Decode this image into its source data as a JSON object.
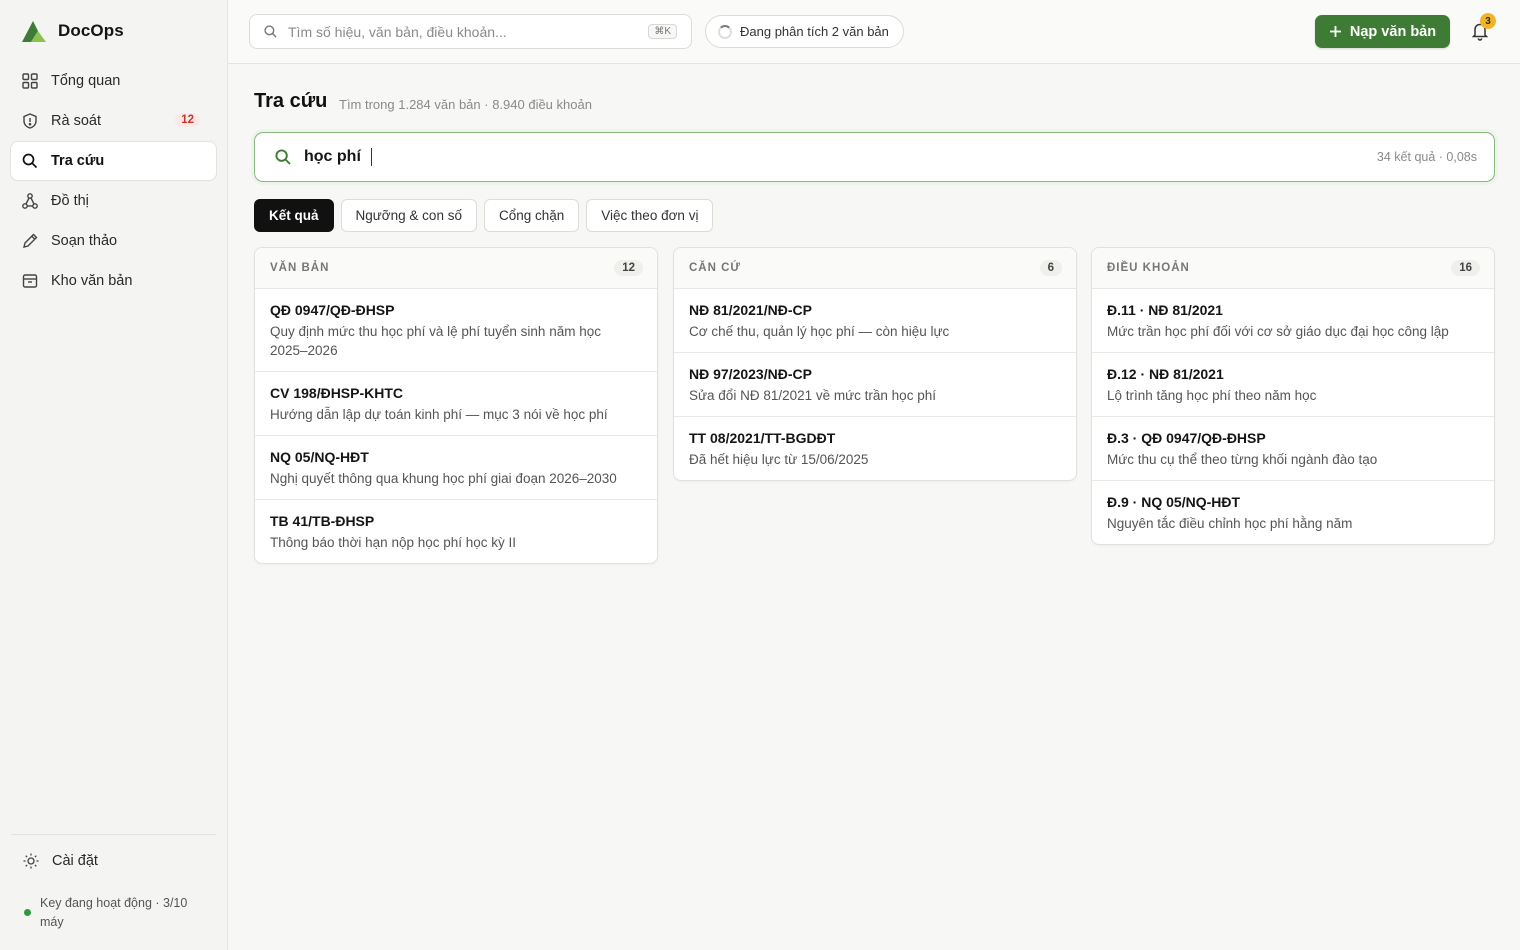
{
  "brand": {
    "name": "DocOps",
    "logo_color": "#3e7b34"
  },
  "sidebar": {
    "items": [
      {
        "label": "Tổng quan",
        "icon": "grid-icon"
      },
      {
        "label": "Rà soát",
        "icon": "shield-icon",
        "badge": "12"
      },
      {
        "label": "Tra cứu",
        "icon": "search-icon",
        "active": true
      },
      {
        "label": "Đồ thị",
        "icon": "graph-icon"
      },
      {
        "label": "Soạn thảo",
        "icon": "pen-icon"
      },
      {
        "label": "Kho văn bản",
        "icon": "archive-icon"
      }
    ],
    "settings_label": "Cài đặt",
    "key_status": "Key đang hoạt động · 3/10 máy"
  },
  "topbar": {
    "search_placeholder": "Tìm số hiệu, văn bản, điều khoản...",
    "shortcut": "⌘K",
    "analyzing": "Đang phân tích 2 văn bản",
    "upload_label": "Nạp văn bản",
    "notification_count": "3"
  },
  "main": {
    "title": "Tra cứu",
    "subtitle": "Tìm trong 1.284 văn bản · 8.940 điều khoản",
    "query": "học phí",
    "result_meta": "34 kết quả · 0,08s",
    "tabs": [
      {
        "label": "Kết quả",
        "active": true
      },
      {
        "label": "Ngưỡng & con số"
      },
      {
        "label": "Cổng chặn"
      },
      {
        "label": "Việc theo đơn vị"
      }
    ],
    "columns": [
      {
        "title": "VĂN BẢN",
        "count": "12",
        "rows": [
          {
            "title": "QĐ 0947/QĐ-ĐHSP",
            "desc": "Quy định mức thu học phí và lệ phí tuyển sinh năm học 2025–2026"
          },
          {
            "title": "CV 198/ĐHSP-KHTC",
            "desc": "Hướng dẫn lập dự toán kinh phí — mục 3 nói về học phí"
          },
          {
            "title": "NQ 05/NQ-HĐT",
            "desc": "Nghị quyết thông qua khung học phí giai đoạn 2026–2030"
          },
          {
            "title": "TB 41/TB-ĐHSP",
            "desc": "Thông báo thời hạn nộp học phí học kỳ II"
          }
        ]
      },
      {
        "title": "CĂN CỨ",
        "count": "6",
        "rows": [
          {
            "title": "NĐ 81/2021/NĐ-CP",
            "desc": "Cơ chế thu, quản lý học phí — còn hiệu lực"
          },
          {
            "title": "NĐ 97/2023/NĐ-CP",
            "desc": "Sửa đổi NĐ 81/2021 về mức trần học phí"
          },
          {
            "title": "TT 08/2021/TT-BGDĐT",
            "desc": "Đã hết hiệu lực từ 15/06/2025"
          }
        ]
      },
      {
        "title": "ĐIỀU KHOẢN",
        "count": "16",
        "rows": [
          {
            "title": "Đ.11 · NĐ 81/2021",
            "desc": "Mức trần học phí đối với cơ sở giáo dục đại học công lập"
          },
          {
            "title": "Đ.12 · NĐ 81/2021",
            "desc": "Lộ trình tăng học phí theo năm học"
          },
          {
            "title": "Đ.3 · QĐ 0947/QĐ-ĐHSP",
            "desc": "Mức thu cụ thể theo từng khối ngành đào tạo"
          },
          {
            "title": "Đ.9 · NQ 05/NQ-HĐT",
            "desc": "Nguyên tắc điều chỉnh học phí hằng năm"
          }
        ]
      }
    ]
  }
}
